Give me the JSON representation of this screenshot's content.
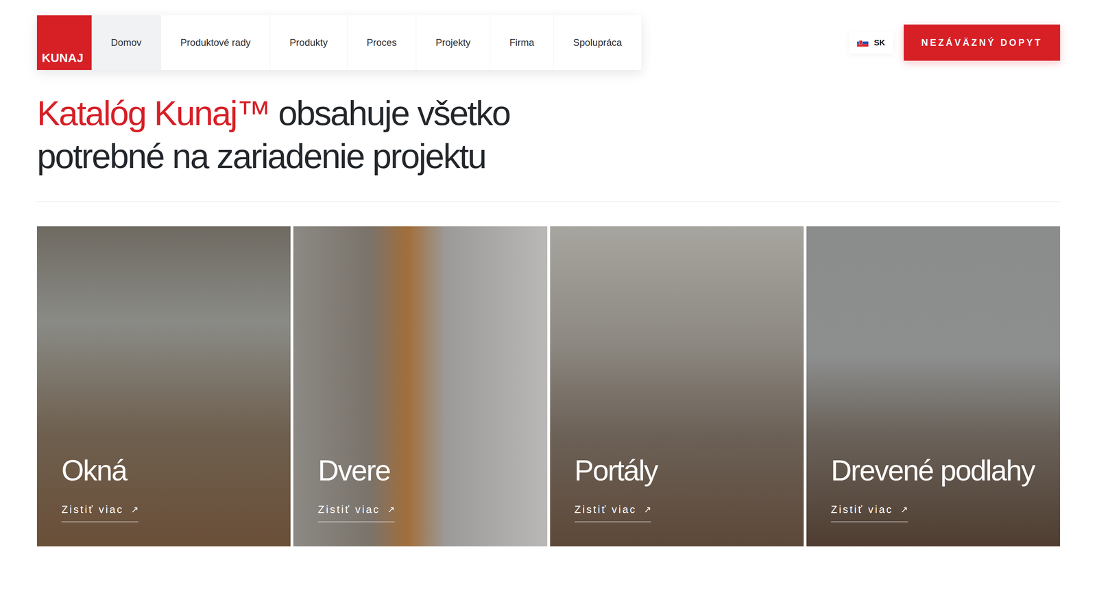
{
  "nav": {
    "logo": "KUNAJ",
    "items": [
      {
        "label": "Domov",
        "selected": true
      },
      {
        "label": "Produktové rady",
        "selected": false
      },
      {
        "label": "Produkty",
        "selected": false
      },
      {
        "label": "Proces",
        "selected": false
      },
      {
        "label": "Projekty",
        "selected": false
      },
      {
        "label": "Firma",
        "selected": false
      },
      {
        "label": "Spolupráca",
        "selected": false
      }
    ]
  },
  "language": {
    "code": "SK"
  },
  "cta": "NEZÁVÄZNÝ DOPYT",
  "heading": {
    "highlight": "Katalóg Kunaj™",
    "rest": " obsahuje všetko",
    "line2": "potrebné na zariadenie projektu"
  },
  "categories": [
    {
      "title": "Okná",
      "link": "Zistiť viac",
      "arrow": "↗"
    },
    {
      "title": "Dvere",
      "link": "Zistiť viac",
      "arrow": "↗"
    },
    {
      "title": "Portály",
      "link": "Zistiť viac",
      "arrow": "↗"
    },
    {
      "title": "Drevené podlahy",
      "link": "Zistiť viac",
      "arrow": "↗"
    }
  ]
}
